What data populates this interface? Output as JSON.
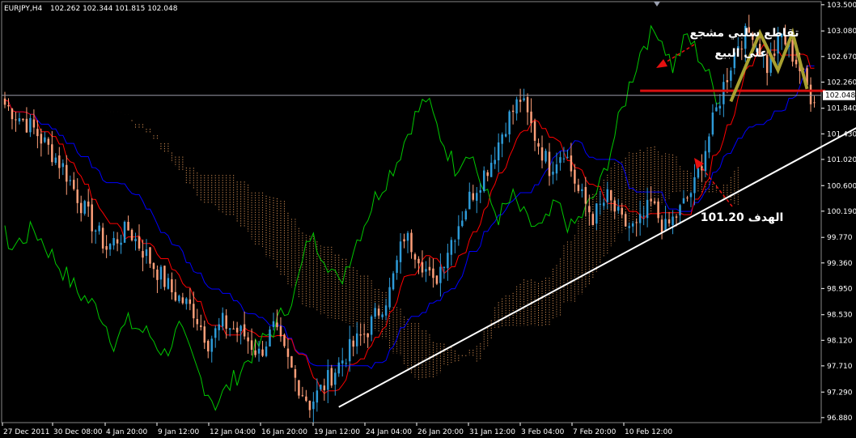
{
  "header": {
    "symbol": "EURJPY,H4",
    "ohlc": "102.262 102.344 101.815 102.048"
  },
  "chart_data": {
    "type": "candlestick",
    "ylim": [
      96.8,
      103.55
    ],
    "y_ticks": [
      "103.500",
      "103.080",
      "102.670",
      "102.260",
      "101.840",
      "101.430",
      "101.020",
      "100.600",
      "100.190",
      "99.770",
      "99.360",
      "98.950",
      "98.530",
      "98.120",
      "97.710",
      "97.290",
      "96.880"
    ],
    "x_ticks": [
      "27 Dec 2011",
      "30 Dec 08:00",
      "4 Jan 20:00",
      "9 Jan 12:00",
      "12 Jan 04:00",
      "16 Jan 20:00",
      "19 Jan 12:00",
      "24 Jan 04:00",
      "26 Jan 20:00",
      "31 Jan 12:00",
      "3 Feb 04:00",
      "7 Feb 20:00",
      "10 Feb 12:00"
    ],
    "current_price": "102.048",
    "close_path": [
      [
        0,
        101.9
      ],
      [
        8,
        101.5
      ],
      [
        16,
        100.9
      ],
      [
        22,
        100.2
      ],
      [
        28,
        99.6
      ],
      [
        34,
        99.9
      ],
      [
        40,
        99.4
      ],
      [
        46,
        98.9
      ],
      [
        52,
        98.6
      ],
      [
        56,
        98.1
      ],
      [
        60,
        98.4
      ],
      [
        66,
        98.2
      ],
      [
        70,
        97.9
      ],
      [
        74,
        98.3
      ],
      [
        80,
        97.5
      ],
      [
        84,
        97.1
      ],
      [
        88,
        97.4
      ],
      [
        94,
        97.9
      ],
      [
        100,
        98.3
      ],
      [
        106,
        98.9
      ],
      [
        110,
        99.8
      ],
      [
        114,
        99.5
      ],
      [
        118,
        99.0
      ],
      [
        122,
        99.6
      ],
      [
        128,
        100.4
      ],
      [
        134,
        101.0
      ],
      [
        138,
        101.6
      ],
      [
        142,
        102.0
      ],
      [
        146,
        101.4
      ],
      [
        150,
        100.9
      ],
      [
        154,
        101.2
      ],
      [
        158,
        100.5
      ],
      [
        162,
        100.1
      ],
      [
        166,
        100.4
      ],
      [
        170,
        100.0
      ],
      [
        174,
        99.9
      ],
      [
        178,
        100.3
      ],
      [
        182,
        99.9
      ],
      [
        186,
        100.2
      ],
      [
        190,
        100.6
      ],
      [
        194,
        101.4
      ],
      [
        198,
        102.2
      ],
      [
        202,
        102.9
      ],
      [
        206,
        103.1
      ],
      [
        210,
        102.5
      ],
      [
        214,
        103.0
      ],
      [
        218,
        102.6
      ],
      [
        222,
        102.05
      ]
    ],
    "indicators": {
      "kijun_color": "#0000ff",
      "tenkan_color": "#ff0000",
      "chikou_color": "#00c800",
      "cloud_color": "#f4a460",
      "trendline_color": "#ffffff",
      "neckline_color": "#d81010",
      "pattern_color": "#a8a030",
      "bull_candle_color": "#2e9bd8",
      "bear_candle_color": "#ffa07a"
    },
    "annotations": [
      {
        "text": "تقاطع سلبي مشجع",
        "role": "signal-label"
      },
      {
        "text": "على البيع",
        "role": "signal-label"
      },
      {
        "text": "الهدف 101.20",
        "role": "target-label"
      }
    ]
  }
}
